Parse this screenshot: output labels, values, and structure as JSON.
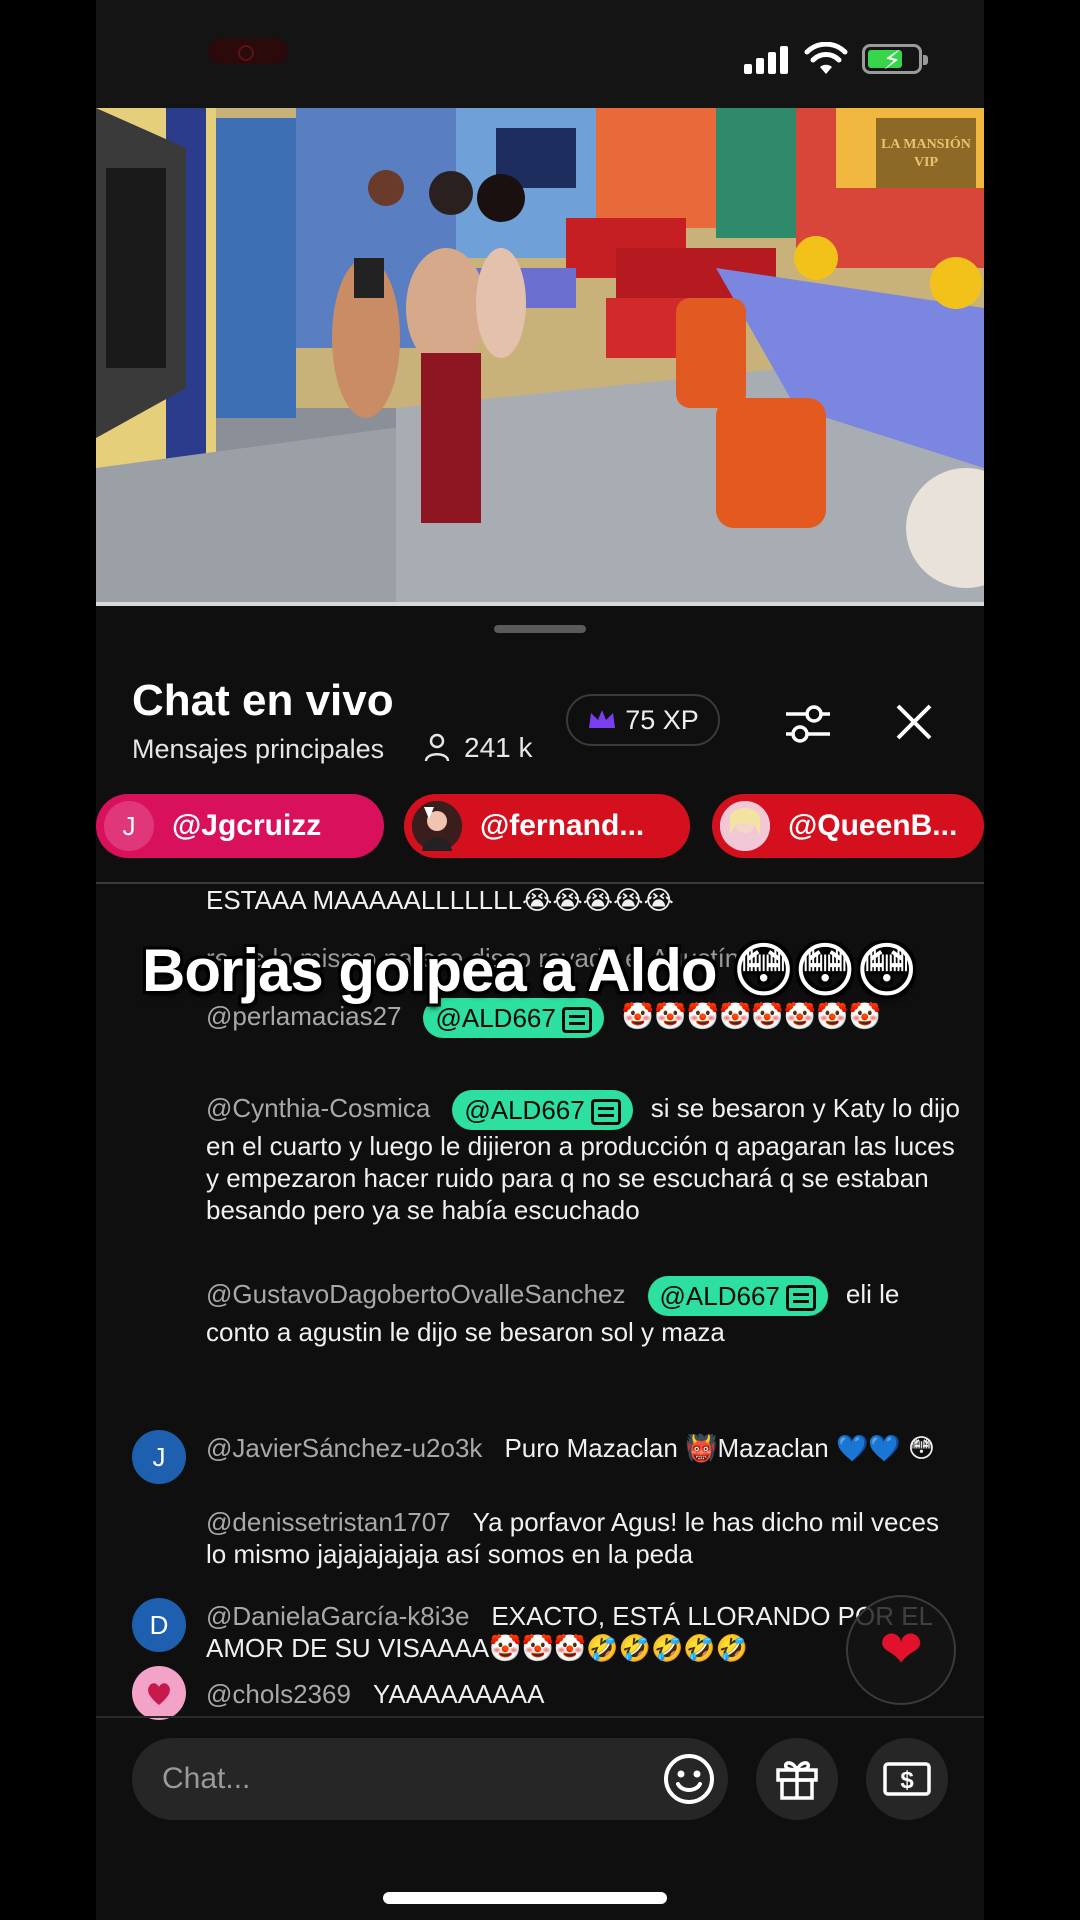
{
  "status_bar": {
    "signal": "signal-icon",
    "wifi": "wifi-icon",
    "battery": "battery-charging-icon",
    "battery_color": "#38d44a"
  },
  "video": {
    "watermark_line1": "LA MANSIÓN",
    "watermark_line2": "VIP"
  },
  "chat": {
    "title": "Chat en vivo",
    "subtitle": "Mensajes principales",
    "viewers": "241 k",
    "xp": "75 XP",
    "pinned": [
      {
        "avatar_letter": "J",
        "handle": "@Jgcruizz",
        "color": "#d9115c"
      },
      {
        "avatar_letter": "",
        "handle": "@fernand...",
        "color": "#d4101f"
      },
      {
        "avatar_letter": "",
        "handle": "@QueenB...",
        "color": "#d4101f"
      }
    ],
    "overlay_caption": "Borjas golpea a Aldo 😳😳😳",
    "messages": [
      {
        "text": "ESTAAA MAAAAALLLLLLL😭😭😭😭😭"
      },
      {
        "text": "re, te lo mismo parece disco rayado el Agustín"
      },
      {
        "author": "@perlamacias27",
        "mention": "@ALD667",
        "text": "🤡🤡🤡🤡🤡🤡🤡🤡"
      },
      {
        "author": "@Cynthia-Cosmica",
        "mention": "@ALD667",
        "text": "si se besaron y Katy lo dijo en el cuarto y luego le dijieron a producción q apagaran las luces y empezaron hacer ruido para q no se escuchará q se estaban besando pero ya se había escuchado"
      },
      {
        "author": "@GustavoDagobertoOvalleSanchez",
        "mention": "@ALD667",
        "text": "eli le conto a agustin le dijo se besaron sol y maza"
      },
      {
        "avatar_letter": "J",
        "author": "@JavierSánchez-u2o3k",
        "text": "Puro Mazaclan 👹Mazaclan 💙💙 😳"
      },
      {
        "author": "@denissetristan1707",
        "text": "Ya porfavor Agus! le has dicho mil veces lo mismo jajajajajaja así somos en la peda"
      },
      {
        "avatar_letter": "D",
        "author": "@DanielaGarcía-k8i3e",
        "text": "EXACTO, ESTÁ LLORANDO POR EL AMOR DE SU VISAAAA🤡🤡🤡🤣🤣🤣🤣🤣"
      },
      {
        "author": "@chols2369",
        "text": "YAAAAAAAAA"
      }
    ],
    "input_placeholder": "Chat...",
    "heart": "❤",
    "accent_mention": "#2de0a0"
  }
}
